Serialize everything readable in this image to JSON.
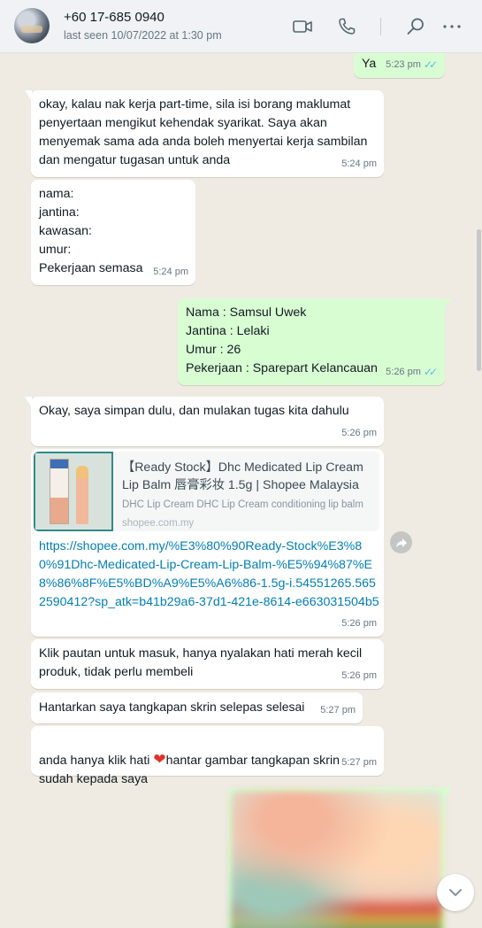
{
  "header": {
    "contact_name": "+60 17-685 0940",
    "last_seen": "last seen 10/07/2022 at 1:30 pm"
  },
  "messages": [
    {
      "dir": "out",
      "text": "Ya",
      "time": "5:23 pm"
    },
    {
      "dir": "in",
      "text": "okay, kalau nak kerja part-time, sila isi borang maklumat penyertaan mengikut kehendak syarikat. Saya akan menyemak sama ada anda boleh menyertai kerja sambilan dan mengatur tugasan untuk anda",
      "time": "5:24 pm"
    },
    {
      "dir": "in",
      "text": "nama:\njantina:\nkawasan:\numur:\nPekerjaan semasa",
      "time": "5:24 pm"
    },
    {
      "dir": "out",
      "text": "Nama : Samsul Uwek\nJantina : Lelaki\nUmur : 26\nPekerjaan : Sparepart Kelancauan",
      "time": "5:26 pm"
    },
    {
      "dir": "in",
      "text": "Okay, saya simpan dulu, dan mulakan tugas kita dahulu",
      "time": "5:26 pm"
    },
    {
      "dir": "in",
      "text": "Klik pautan untuk masuk, hanya nyalakan hati merah kecil produk, tidak perlu membeli",
      "time": "5:26 pm"
    },
    {
      "dir": "in",
      "text": "Hantarkan saya tangkapan skrin selepas selesai",
      "time": "5:27 pm"
    },
    {
      "dir": "in",
      "text_before": "anda hanya klik hati ",
      "text_after": "hantar gambar tangkapan skrin sudah kepada saya",
      "time": "5:27 pm"
    }
  ],
  "link_message": {
    "preview_title": "【Ready Stock】Dhc Medicated Lip Cream Lip Balm 唇膏彩妆 1.5g | Shopee Malaysia",
    "preview_desc": "DHC Lip Cream DHC Lip Cream conditioning lip balm",
    "preview_domain": "shopee.com.my",
    "url": "https://shopee.com.my/%E3%80%90Ready-Stock%E3%80%91Dhc-Medicated-Lip-Cream-Lip-Balm-%E5%94%87%E8%86%8F%E5%BD%A9%E5%A6%86-1.5g-i.54551265.5652590412?sp_atk=b41b29a6-37d1-421e-8614-e663031504b5",
    "time": "5:26 pm",
    "thumb_label": "DHC"
  },
  "icons": {
    "video": "video-camera-icon",
    "call": "phone-icon",
    "search": "search-icon",
    "menu": "more-options-icon",
    "read_receipt": "double-check-icon"
  },
  "colors": {
    "incoming": "#ffffff",
    "outgoing": "#d9fdd3",
    "background": "#efeae2",
    "link": "#027eb5",
    "read_tick": "#53bdeb"
  }
}
